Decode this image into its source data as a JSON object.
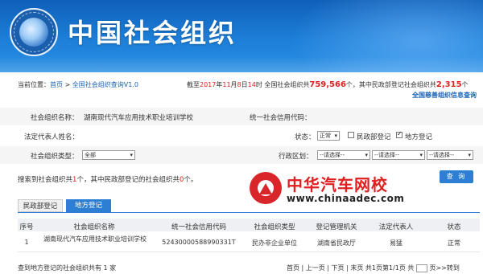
{
  "header": {
    "title": "中国社会组织"
  },
  "breadcrumb": {
    "prefix": "当前位置：",
    "home": "首页",
    "sep": " > ",
    "current": "全国社会组织查询V1.0"
  },
  "stats": {
    "t1": "截至",
    "year": "2017",
    "t2": "年",
    "month": "11",
    "t3": "月",
    "day": "8",
    "t4": "日",
    "hour": "14",
    "t5": "时 全国社会组织共",
    "total": "759,566",
    "t6": "个，其中民政部登记社会组织共",
    "ministry": "2,315",
    "t7": "个"
  },
  "charity_link": "全国慈善组织信息查询",
  "form": {
    "org_name_label": "社会组织名称：",
    "org_name_value": "湖南现代汽车应用技术职业培训学校",
    "credit_code_label": "统一社会信用代码：",
    "legal_rep_label": "法定代表人姓名：",
    "status_label": "状态：",
    "status_value": "正常",
    "cb_ministry": "民政部登记",
    "cb_local": "地方登记",
    "type_label": "社会组织类型：",
    "type_value": "全部",
    "region_label": "行政区划：",
    "region1": "--请选择--",
    "region2": "--请选择--",
    "region3": "--请选择--"
  },
  "result": {
    "t1": "搜索到社会组织共",
    "count": "1",
    "t2": "个，其中民政部登记的社会组织共",
    "ministry_count": "0",
    "t3": "个。"
  },
  "search_button": "查 询",
  "watermark": {
    "cn": "中华汽车网校",
    "url": "www.chinaadec.com"
  },
  "tabs": [
    "民政部登记",
    "地方登记"
  ],
  "table": {
    "headers": [
      "序号",
      "社会组织名称",
      "统一社会信用代码",
      "社会组织类型",
      "登记管理机关",
      "法定代表人",
      "状态"
    ],
    "rows": [
      [
        "1",
        "湖南现代汽车应用技术职业培训学校",
        "52430000588990331T",
        "民办非企业单位",
        "湖南省民政厅",
        "易猛",
        "正常"
      ]
    ]
  },
  "footer": {
    "left": "查到地方登记的社会组织共有 1 家",
    "pager": "首页 | 上一页 | 下页 | 末页 共1页第1/1页 共 ",
    "pager_end": " 页>>转到"
  }
}
